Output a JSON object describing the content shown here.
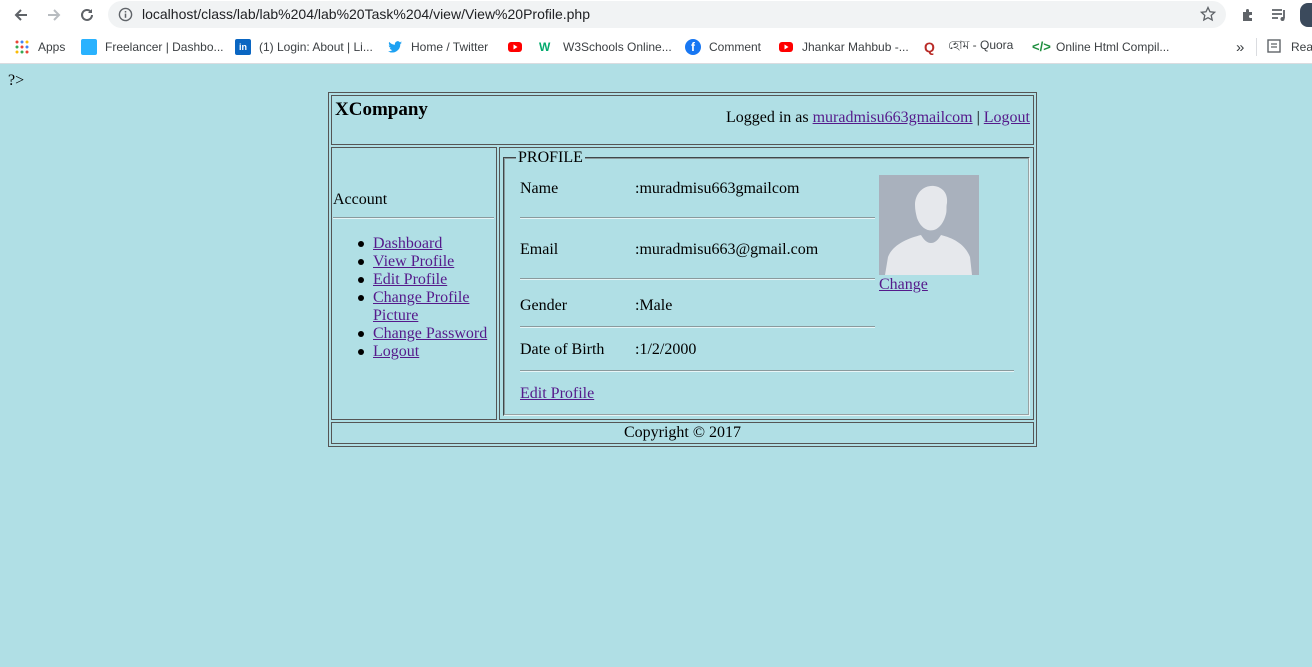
{
  "browser": {
    "url": "localhost/class/lab/lab%204/lab%20Task%204/view/View%20Profile.php",
    "bookmarks": [
      {
        "label": "Apps",
        "icon": "apps-grid-icon"
      },
      {
        "label": "Freelancer | Dashbo...",
        "icon": "freelancer-icon"
      },
      {
        "label": "(1) Login: About | Li...",
        "icon": "linkedin-icon"
      },
      {
        "label": "Home / Twitter",
        "icon": "twitter-icon"
      },
      {
        "label": "",
        "icon": "youtube-icon"
      },
      {
        "label": "W3Schools Online...",
        "icon": "w3schools-icon"
      },
      {
        "label": "Comment",
        "icon": "facebook-icon"
      },
      {
        "label": "Jhankar Mahbub -...",
        "icon": "youtube-icon"
      },
      {
        "label": "হোম - Quora",
        "icon": "quora-icon"
      },
      {
        "label": "Online Html Compil...",
        "icon": "code-icon"
      }
    ],
    "overflow_label": "»",
    "reading_list_label": "Read"
  },
  "page": {
    "php_tail": "?>",
    "brand": "XCompany",
    "logged_in_prefix": "Logged in as ",
    "username": "muradmisu663gmailcom",
    "separator": " | ",
    "logout_top": "Logout",
    "sidebar": {
      "title": "Account",
      "items": [
        {
          "label": "Dashboard"
        },
        {
          "label": "View Profile"
        },
        {
          "label": "Edit Profile"
        },
        {
          "label": "Change Profile Picture"
        },
        {
          "label": "Change Password"
        },
        {
          "label": "Logout"
        }
      ]
    },
    "profile": {
      "legend": "PROFILE",
      "rows": [
        {
          "label": "Name",
          "value": ":muradmisu663gmailcom"
        },
        {
          "label": "Email",
          "value": ":muradmisu663@gmail.com"
        },
        {
          "label": "Gender",
          "value": ":Male"
        },
        {
          "label": "Date of Birth",
          "value": ":1/2/2000"
        }
      ],
      "change_label": "Change",
      "edit_label": "Edit Profile"
    },
    "footer": "Copyright © 2017",
    "colors": {
      "background": "#b0dfe5",
      "link": "#551a8b"
    }
  }
}
